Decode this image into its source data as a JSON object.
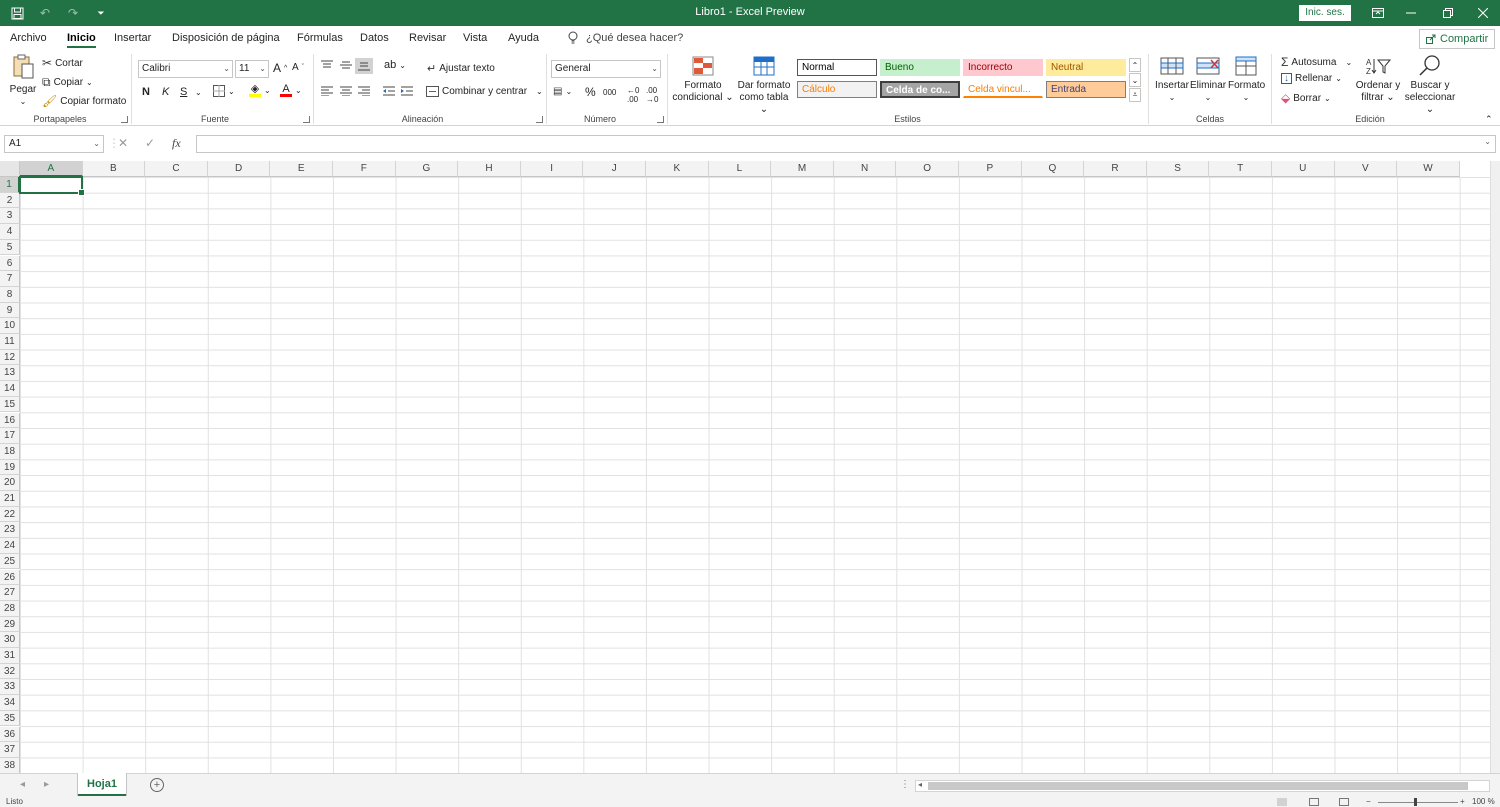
{
  "titlebar": {
    "title": "Libro1  -  Excel Preview",
    "signin_label": "Inic. ses."
  },
  "tabs": [
    {
      "label": "Archivo"
    },
    {
      "label": "Inicio"
    },
    {
      "label": "Insertar"
    },
    {
      "label": "Disposición de página"
    },
    {
      "label": "Fórmulas"
    },
    {
      "label": "Datos"
    },
    {
      "label": "Revisar"
    },
    {
      "label": "Vista"
    },
    {
      "label": "Ayuda"
    }
  ],
  "tellme_placeholder": "¿Qué desea hacer?",
  "share_label": "Compartir",
  "ribbon": {
    "clipboard": {
      "paste": "Pegar",
      "cut": "Cortar",
      "copy": "Copiar",
      "format_painter": "Copiar formato",
      "group": "Portapapeles"
    },
    "font": {
      "font_name": "Calibri",
      "font_size": "11",
      "bold": "N",
      "italic": "K",
      "underline": "S",
      "group": "Fuente"
    },
    "alignment": {
      "wrap": "Ajustar texto",
      "merge": "Combinar y centrar",
      "group": "Alineación"
    },
    "number": {
      "format": "General",
      "percent": "%",
      "thousands": "000",
      "group": "Número"
    },
    "styles": {
      "conditional_line1": "Formato",
      "conditional_line2": "condicional",
      "table_line1": "Dar formato",
      "table_line2": "como tabla",
      "normal": "Normal",
      "bueno": "Bueno",
      "incorrecto": "Incorrecto",
      "neutral": "Neutral",
      "calculo": "Cálculo",
      "celda_comp": "Celda de co...",
      "celda_vinc": "Celda vincul...",
      "entrada": "Entrada",
      "group": "Estilos"
    },
    "cells": {
      "insert": "Insertar",
      "delete": "Eliminar",
      "format": "Formato",
      "group": "Celdas"
    },
    "editing": {
      "autosum": "Autosuma",
      "fill": "Rellenar",
      "clear": "Borrar",
      "sort_line1": "Ordenar y",
      "sort_line2": "filtrar",
      "find_line1": "Buscar y",
      "find_line2": "seleccionar",
      "group": "Edición"
    }
  },
  "formula_bar": {
    "name_box": "A1",
    "cancel": "✕",
    "enter": "✓",
    "fx": "fx",
    "formula": ""
  },
  "columns": [
    "A",
    "B",
    "C",
    "D",
    "E",
    "F",
    "G",
    "H",
    "I",
    "J",
    "K",
    "L",
    "M",
    "N",
    "O",
    "P",
    "Q",
    "R",
    "S",
    "T",
    "U",
    "V",
    "W"
  ],
  "rows": [
    "1",
    "2",
    "3",
    "4",
    "5",
    "6",
    "7",
    "8",
    "9",
    "10",
    "11",
    "12",
    "13",
    "14",
    "15",
    "16",
    "17",
    "18",
    "19",
    "20",
    "21",
    "22",
    "23",
    "24",
    "25",
    "26",
    "27",
    "28",
    "29",
    "30",
    "31",
    "32",
    "33",
    "34",
    "35",
    "36",
    "37",
    "38"
  ],
  "active_cell": "A1",
  "sheets": [
    {
      "label": "Hoja1"
    }
  ],
  "status": {
    "ready": "Listo",
    "zoom": "100 %"
  },
  "colors": {
    "accent": "#217346",
    "bueno_bg": "#c6efce",
    "incorrecto_bg": "#ffc7ce",
    "neutral_bg": "#ffeb9c",
    "entrada_bg": "#ffcc99",
    "celda_comp_bg": "#a5a5a5"
  }
}
